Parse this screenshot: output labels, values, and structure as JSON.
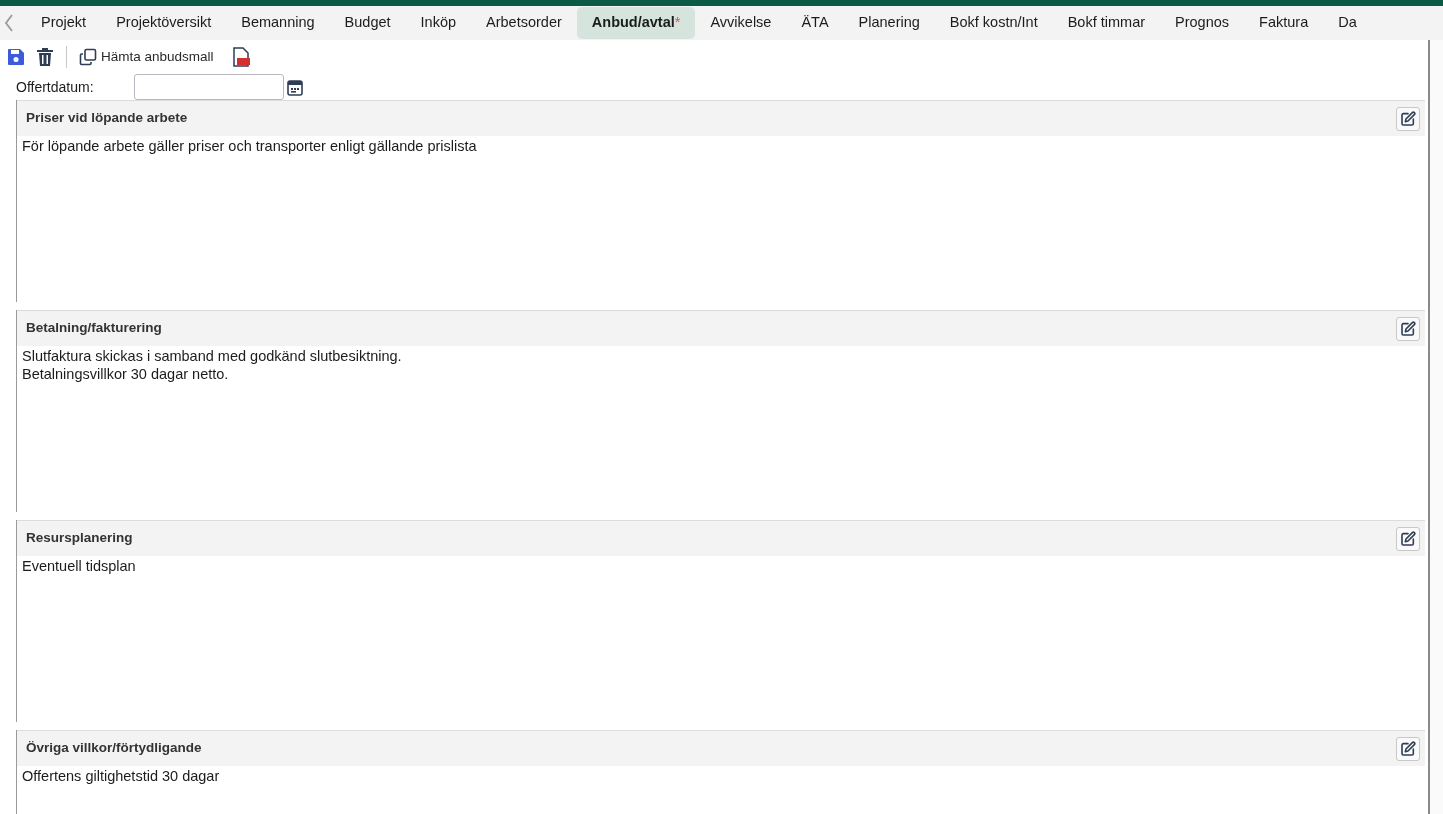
{
  "tabs": [
    {
      "label": "Projekt",
      "selected": false
    },
    {
      "label": "Projektöversikt",
      "selected": false
    },
    {
      "label": "Bemanning",
      "selected": false
    },
    {
      "label": "Budget",
      "selected": false
    },
    {
      "label": "Inköp",
      "selected": false
    },
    {
      "label": "Arbetsorder",
      "selected": false
    },
    {
      "label": "Anbud/avtal",
      "selected": true,
      "modified_mark": "*"
    },
    {
      "label": "Avvikelse",
      "selected": false
    },
    {
      "label": "ÄTA",
      "selected": false
    },
    {
      "label": "Planering",
      "selected": false
    },
    {
      "label": "Bokf kostn/Int",
      "selected": false
    },
    {
      "label": "Bokf timmar",
      "selected": false
    },
    {
      "label": "Prognos",
      "selected": false
    },
    {
      "label": "Faktura",
      "selected": false
    },
    {
      "label": "Da",
      "selected": false
    }
  ],
  "toolbar": {
    "template_button": "Hämta anbudsmall"
  },
  "offer_date": {
    "label": "Offertdatum:"
  },
  "sections": [
    {
      "title": "Priser vid löpande arbete",
      "lines": [
        "För löpande arbete gäller priser och transporter enligt gällande prislista"
      ]
    },
    {
      "title": "Betalning/fakturering",
      "lines": [
        "Slutfaktura skickas i samband med godkänd slutbesiktning.",
        "Betalningsvillkor 30 dagar netto."
      ]
    },
    {
      "title": "Resursplanering",
      "lines": [
        "Eventuell tidsplan"
      ]
    },
    {
      "title": "Övriga villkor/förtydligande",
      "lines": [
        "Offertens giltighetstid 30 dagar"
      ]
    }
  ]
}
